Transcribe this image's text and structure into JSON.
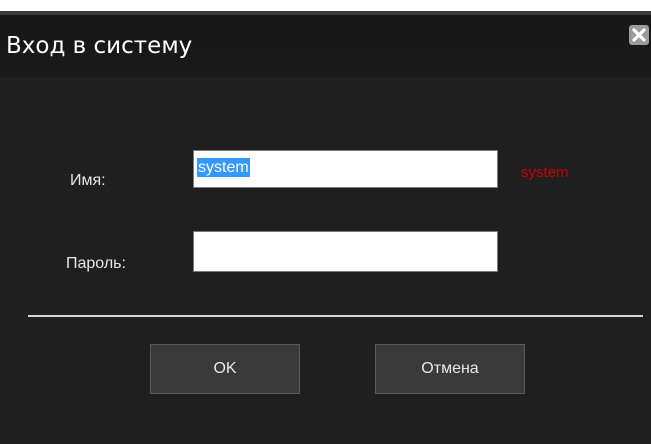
{
  "dialog": {
    "title": "Вход в систему",
    "close_icon": "close-icon"
  },
  "form": {
    "username_label": "Имя:",
    "username_value": "system",
    "username_hint": "system",
    "password_label": "Пароль:",
    "password_value": ""
  },
  "buttons": {
    "ok_label": "OK",
    "cancel_label": "Отмена"
  },
  "colors": {
    "background": "#1f1f1f",
    "hint": "#cc0000",
    "selection": "#3399ff"
  }
}
